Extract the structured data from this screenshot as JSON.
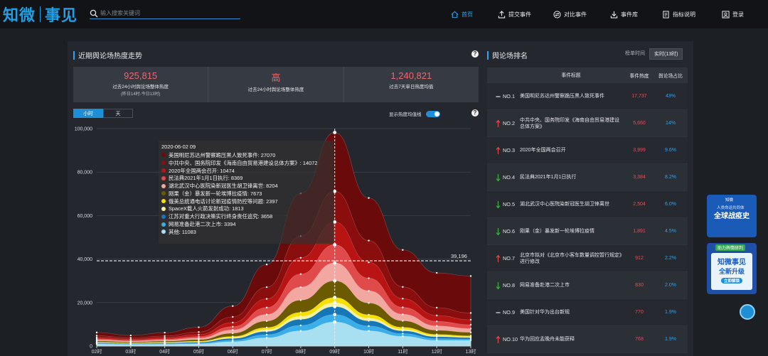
{
  "header": {
    "logo_left": "知微",
    "logo_right": "事见",
    "search_placeholder": "输入搜索关键词",
    "nav": [
      {
        "label": "首页",
        "icon": "home-icon",
        "active": true
      },
      {
        "label": "提交事件",
        "icon": "submit-icon",
        "active": false
      },
      {
        "label": "对比事件",
        "icon": "compare-icon",
        "active": false
      },
      {
        "label": "事件库",
        "icon": "download-icon",
        "active": false
      },
      {
        "label": "指标说明",
        "icon": "document-icon",
        "active": false
      },
      {
        "label": "登录",
        "icon": "user-icon",
        "active": false
      }
    ]
  },
  "left": {
    "title": "近期舆论场热度走势",
    "stats": [
      {
        "value": "925,815",
        "label": "过去24小时舆论场整体热度",
        "sub": "(昨日14时-今日13时)"
      },
      {
        "value": "高",
        "label": "过去24小时舆论场整体热度",
        "sub": ""
      },
      {
        "value": "1,240,821",
        "label": "过去7天单日热度均值",
        "sub": ""
      }
    ],
    "tabs": [
      "小时",
      "天"
    ],
    "toggle_label": "显示热度均值线",
    "mean_line_label": "39,196"
  },
  "tooltip": {
    "date": "2020-06-02 09",
    "items": [
      {
        "text": "美国明尼苏达州警察跪压黑人致死事件: 27070",
        "color": "#6b0a0a"
      },
      {
        "text": "中共中央、国务院印发《海南自由贸易港建设总体方案》: 14072",
        "color": "#8b0e0e"
      },
      {
        "text": "2020年全国两会召开: 10474",
        "color": "#b81414"
      },
      {
        "text": "民法典2021年1月1日执行: 8369",
        "color": "#e04a4a"
      },
      {
        "text": "湖北武汉中心医院染新冠医生胡卫锋离世: 8204",
        "color": "#f2a7a0"
      },
      {
        "text": "刚果（金）暴发新一轮埃博拉疫情: 7673",
        "color": "#6b5a00"
      },
      {
        "text": "俄美总统通电话讨论新冠疫情防控等问题: 2397",
        "color": "#f5e000"
      },
      {
        "text": "SpaceX载人火箭发射成功: 1813",
        "color": "#f7f0a0"
      },
      {
        "text": "江苏对重大行政决策实行终身责任追究: 3658",
        "color": "#1677b8"
      },
      {
        "text": "网易准备赴港二次上市: 3394",
        "color": "#3aaee8"
      },
      {
        "text": "其他: 11083",
        "color": "#a8e0f2"
      }
    ]
  },
  "chart_data": {
    "type": "area",
    "x": [
      "02时",
      "03时",
      "04时",
      "05时",
      "06时",
      "07时",
      "08时",
      "09时",
      "10时",
      "11时",
      "12时",
      "13时"
    ],
    "ylim": [
      0,
      100000
    ],
    "yticks": [
      "0",
      "20,000",
      "40,000",
      "60,000",
      "80,000",
      "100,000"
    ],
    "mean_line": 39196,
    "stacked": true,
    "series": [
      {
        "name": "其他",
        "color": "#a8e0f2",
        "values": [
          900,
          700,
          800,
          1000,
          2000,
          3800,
          7000,
          11083,
          7000,
          4500,
          2600,
          2600
        ]
      },
      {
        "name": "网易准备赴港二次上市",
        "color": "#3aaee8",
        "values": [
          300,
          250,
          300,
          400,
          700,
          1400,
          2500,
          3394,
          2200,
          1200,
          800,
          600
        ]
      },
      {
        "name": "江苏对重大行政决策实行终身责任追究",
        "color": "#1677b8",
        "values": [
          300,
          250,
          300,
          400,
          800,
          1500,
          2800,
          3658,
          2400,
          1300,
          900,
          700
        ]
      },
      {
        "name": "SpaceX载人火箭发射成功",
        "color": "#f7f0a0",
        "values": [
          150,
          120,
          150,
          200,
          400,
          800,
          1400,
          1813,
          1200,
          700,
          450,
          350
        ]
      },
      {
        "name": "俄美总统通电话讨论新冠疫情防控等问题",
        "color": "#f5e000",
        "values": [
          200,
          150,
          200,
          250,
          500,
          1000,
          1800,
          2397,
          1600,
          900,
          600,
          450
        ]
      },
      {
        "name": "刚果（金）暴发新一轮埃博拉疫情",
        "color": "#6b5a00",
        "values": [
          500,
          400,
          500,
          700,
          1500,
          3000,
          5600,
          7673,
          5400,
          3000,
          1900,
          1600
        ]
      },
      {
        "name": "湖北武汉中心医院染新冠医生胡卫锋离世",
        "color": "#f2a7a0",
        "values": [
          500,
          400,
          500,
          700,
          1500,
          3000,
          6000,
          8204,
          5600,
          3000,
          2000,
          1700
        ]
      },
      {
        "name": "民法典2021年1月1日执行",
        "color": "#e04a4a",
        "values": [
          500,
          400,
          500,
          700,
          1500,
          3200,
          6000,
          8369,
          5800,
          3200,
          2100,
          1800
        ]
      },
      {
        "name": "2020年全国两会召开",
        "color": "#b81414",
        "values": [
          600,
          500,
          600,
          900,
          1900,
          4000,
          7500,
          10474,
          7300,
          4000,
          2700,
          2300
        ]
      },
      {
        "name": "中共中央、国务院印发《海南自由贸易港建设总体方案》",
        "color": "#8b0e0e",
        "values": [
          800,
          600,
          800,
          1200,
          2600,
          5400,
          10000,
          14072,
          10000,
          5400,
          3600,
          3100
        ]
      },
      {
        "name": "美国明尼苏达州警察跪压黑人致死事件",
        "color": "#6b0a0a",
        "values": [
          1500,
          1100,
          1500,
          2200,
          5000,
          10400,
          19600,
          27070,
          19600,
          17000,
          16000,
          17000
        ]
      }
    ]
  },
  "right": {
    "title": "舆论场排名",
    "time_label": "榜单时间",
    "time_value": "实时(13时)",
    "columns": [
      "事件标题",
      "事件热度",
      "舆论场占比"
    ],
    "rows": [
      {
        "rank": "NO.1",
        "trend": "flat",
        "title": "美国明尼苏达州警察跪压黑人致死事件",
        "heat": "17,737",
        "pct": "43%"
      },
      {
        "rank": "NO.2",
        "trend": "up",
        "title": "中共中央、国务院印发《海南自由贸易港建设总体方案》",
        "heat": "5,660",
        "pct": "14%"
      },
      {
        "rank": "NO.3",
        "trend": "up",
        "title": "2020年全国两会召开",
        "heat": "3,999",
        "pct": "9.6%"
      },
      {
        "rank": "NO.4",
        "trend": "down",
        "title": "民法典2021年1月1日执行",
        "heat": "3,384",
        "pct": "8.2%"
      },
      {
        "rank": "NO.5",
        "trend": "down",
        "title": "湖北武汉中心医院染新冠医生胡卫锋离世",
        "heat": "2,504",
        "pct": "6.0%"
      },
      {
        "rank": "NO.6",
        "trend": "down",
        "title": "刚果（金）暴发新一轮埃博拉疫情",
        "heat": "1,891",
        "pct": "4.5%"
      },
      {
        "rank": "NO.7",
        "trend": "up",
        "title": "北京市拟对《北京市小客车数量调控暂行规定》进行修改",
        "heat": "912",
        "pct": "2.2%"
      },
      {
        "rank": "NO.8",
        "trend": "down",
        "title": "网易准备赴港二次上市",
        "heat": "830",
        "pct": "2.0%"
      },
      {
        "rank": "NO.9",
        "trend": "flat",
        "title": "美国针对华为出台新规",
        "heat": "770",
        "pct": "1.9%"
      },
      {
        "rank": "NO.10",
        "trend": "up",
        "title": "华为回应孟晚舟未能获释",
        "heat": "768",
        "pct": "1.9%"
      }
    ]
  },
  "ads": {
    "ad1_tag": "知微",
    "ad1_line": "人类命运共同体",
    "ad1_main": "全球战疫史",
    "ad2_tag": "助力舆情研判",
    "ad2_main": "知微事见",
    "ad2_sub": "全新升级",
    "ad2_btn": "立即解锁"
  },
  "colors": {
    "accent": "#1e8fd6",
    "heat_red": "#d7545a",
    "up_arrow": "#e04a4a",
    "down_arrow": "#3cb043"
  }
}
